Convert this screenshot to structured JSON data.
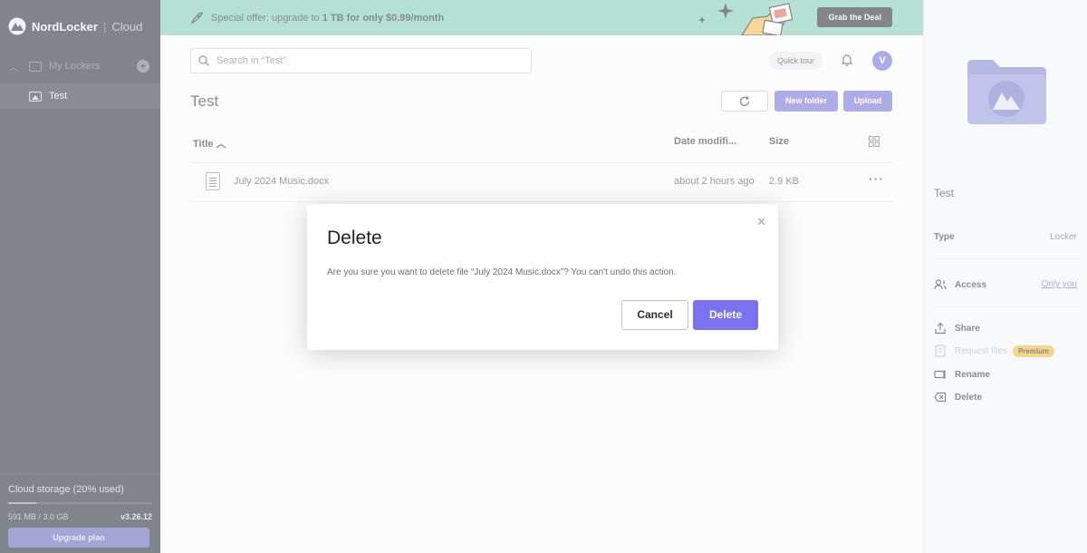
{
  "sidebar": {
    "brand_name": "NordLocker",
    "brand_separator": "|",
    "brand_sub": "Cloud",
    "my_lockers_label": "My Lockers",
    "lockers": [
      {
        "label": "Test"
      }
    ],
    "storage": {
      "label": "Cloud storage (20% used)",
      "used_fraction": 0.2,
      "usage_text": "591 MB / 3.0 GB",
      "version": "v3.26.12"
    },
    "upgrade_label": "Upgrade plan"
  },
  "banner": {
    "offer_prefix": "Special offer: upgrade to ",
    "offer_bold": "1 TB for only $0.99/month",
    "deal_label": "Grab the Deal"
  },
  "toolbar": {
    "search_placeholder": "Search in “Test”",
    "quick_tour_label": "Quick tour",
    "avatar_initial": "V"
  },
  "page": {
    "title": "Test",
    "new_folder_label": "New folder",
    "upload_label": "Upload"
  },
  "table": {
    "columns": {
      "title": "Title",
      "date": "Date modifi...",
      "size": "Size"
    },
    "rows": [
      {
        "name": "July 2024 Music.docx",
        "date": "about 2 hours ago",
        "size": "2.9 KB"
      }
    ]
  },
  "details": {
    "title": "Test",
    "type_label": "Type",
    "type_value": "Locker",
    "access_label": "Access",
    "access_value": "Only you",
    "actions": [
      {
        "label": "Share"
      },
      {
        "label": "Request files",
        "badge": "Premium"
      },
      {
        "label": "Rename"
      },
      {
        "label": "Delete"
      }
    ]
  },
  "dialog": {
    "title": "Delete",
    "message": "Are you sure you want to delete file “July 2024 Music.docx”? You can't undo this action.",
    "cancel_label": "Cancel",
    "confirm_label": "Delete"
  },
  "colors": {
    "sidebar_bg": "#1b1f2a",
    "banner_bg": "#7cc7b3",
    "accent": "#6a68d4",
    "dialog_confirm": "#7a72ee",
    "premium_badge": "#e9b636"
  }
}
